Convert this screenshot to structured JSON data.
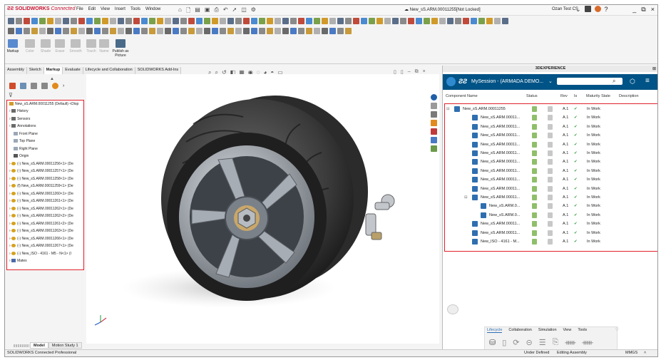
{
  "app": {
    "logo_brand": "SOLIDWORKS",
    "logo_suffix": "Connected",
    "menus": [
      "File",
      "Edit",
      "View",
      "Insert",
      "Tools",
      "Window"
    ],
    "document_title": "New_sS.ARM.00011255[Not Locked]",
    "user": "Ozan Test CS",
    "window_controls": [
      "?",
      "_",
      "□",
      "×"
    ]
  },
  "command_manager": {
    "commands": [
      "Markup",
      "Color",
      "Shade",
      "Erase",
      "Smooth",
      "Touch",
      "Name",
      "Publish as Picture"
    ]
  },
  "tabs": [
    "Assembly",
    "Sketch",
    "Markup",
    "Evaluate",
    "Lifecycle and Collaboration",
    "SOLIDWORKS Add-Ins"
  ],
  "active_tab": "Markup",
  "feature_tree": {
    "root": "New_sS.ARM.00011255 (Default) <Disp",
    "items": [
      {
        "label": "History",
        "type": "folder"
      },
      {
        "label": "Sensors",
        "type": "folder"
      },
      {
        "label": "Annotations",
        "type": "folder"
      },
      {
        "label": "Front Plane",
        "type": "plane"
      },
      {
        "label": "Top Plane",
        "type": "plane"
      },
      {
        "label": "Right Plane",
        "type": "plane"
      },
      {
        "label": "Origin",
        "type": "origin"
      },
      {
        "label": "(-) New_sS.ARM.00011256<1> (De",
        "type": "part"
      },
      {
        "label": "(-) New_sS.ARM.00011257<1> (De",
        "type": "part"
      },
      {
        "label": "(-) New_sS.ARM.00011258<1> (De",
        "type": "part"
      },
      {
        "label": "(f) New_sS.ARM.00011259<1> (De",
        "type": "part"
      },
      {
        "label": "(-) New_sS.ARM.00011260<1> (De",
        "type": "part"
      },
      {
        "label": "(-) New_sS.ARM.00011261<1> (De",
        "type": "part"
      },
      {
        "label": "(-) New_sS.ARM.00011262<1> (De",
        "type": "part"
      },
      {
        "label": "(-) New_sS.ARM.00011262<2> (De",
        "type": "part"
      },
      {
        "label": "(-) New_sS.ARM.00011261<2> (De",
        "type": "part"
      },
      {
        "label": "(-) New_sS.ARM.00011263<1> (De",
        "type": "part"
      },
      {
        "label": "(-) New_sS.ARM.00011266<1> (De",
        "type": "part"
      },
      {
        "label": "(-) New_sS.ARM.00011267<1> (De",
        "type": "part"
      },
      {
        "label": "(-) New_ISO - 4161 - M5 - N<1> (I",
        "type": "part"
      },
      {
        "label": "Mates",
        "type": "mates"
      }
    ]
  },
  "bottom_tabs": [
    "Model",
    "Motion Study 1"
  ],
  "status_bar": {
    "left": "SOLIDWORKS Connected Professional",
    "state": "Under Defined",
    "mode": "Editing Assembly",
    "units": "MMGS"
  },
  "experience_panel": {
    "title": "3DEXPERIENCE",
    "session_label": "MySession - (ARMADA DEMO...",
    "search_placeholder": "",
    "columns": [
      "Component Name",
      "Status",
      "Rev",
      "Is",
      "Maturity State",
      "Description"
    ],
    "rows": [
      {
        "name": "New_sS.ARM.00011255",
        "rev": "A.1",
        "state": "In Work",
        "indent": 0
      },
      {
        "name": "New_sS.ARM.00011...",
        "rev": "A.1",
        "state": "In Work",
        "indent": 1
      },
      {
        "name": "New_sS.ARM.00011...",
        "rev": "A.1",
        "state": "In Work",
        "indent": 1
      },
      {
        "name": "New_sS.ARM.00011...",
        "rev": "A.1",
        "state": "In Work",
        "indent": 1
      },
      {
        "name": "New_sS.ARM.00011...",
        "rev": "A.1",
        "state": "In Work",
        "indent": 1
      },
      {
        "name": "New_sS.ARM.00011...",
        "rev": "A.1",
        "state": "In Work",
        "indent": 1
      },
      {
        "name": "New_sS.ARM.00011...",
        "rev": "A.1",
        "state": "In Work",
        "indent": 1
      },
      {
        "name": "New_sS.ARM.00011...",
        "rev": "A.1",
        "state": "In Work",
        "indent": 1
      },
      {
        "name": "New_sS.ARM.00011...",
        "rev": "A.1",
        "state": "In Work",
        "indent": 1
      },
      {
        "name": "New_sS.ARM.00011...",
        "rev": "A.1",
        "state": "In Work",
        "indent": 1
      },
      {
        "name": "New_sS.ARM.00011...",
        "rev": "A.1",
        "state": "In Work",
        "indent": 1
      },
      {
        "name": "New_sS.ARM.0...",
        "rev": "A.1",
        "state": "In Work",
        "indent": 2
      },
      {
        "name": "New_sS.ARM.0...",
        "rev": "A.1",
        "state": "In Work",
        "indent": 2
      },
      {
        "name": "New_sS.ARM.00011...",
        "rev": "A.1",
        "state": "In Work",
        "indent": 1
      },
      {
        "name": "New_sS.ARM.00011...",
        "rev": "A.1",
        "state": "In Work",
        "indent": 1
      },
      {
        "name": "New_ISO - 4161 - M...",
        "rev": "A.1",
        "state": "In Work",
        "indent": 1
      }
    ],
    "lifecycle_tabs": [
      "Lifecycle",
      "Collaboration",
      "Simulation",
      "View",
      "Tools"
    ],
    "active_lifecycle_tab": "Lifecycle"
  },
  "colors": {
    "highlight_border": "#e0222b",
    "panel_bar": "#005386",
    "check": "#2e9e3a"
  }
}
